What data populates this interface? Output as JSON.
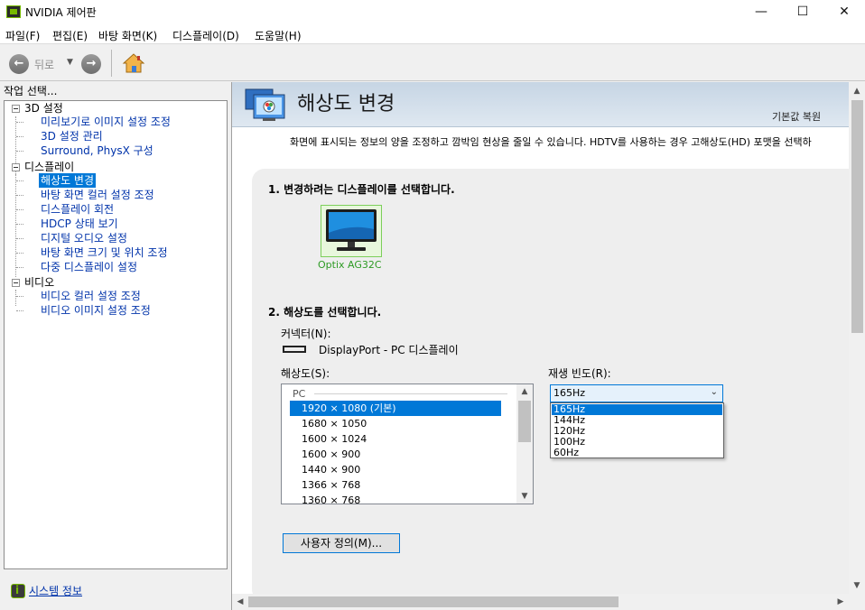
{
  "window": {
    "title": "NVIDIA 제어판",
    "min_glyph": "—",
    "max_glyph": "☐",
    "close_glyph": "✕"
  },
  "menu": [
    "파일(F)",
    "편집(E)",
    "바탕 화면(K)",
    "디스플레이(D)",
    "도움말(H)"
  ],
  "toolbar": {
    "back_label": "뒤로",
    "back_glyph": "←",
    "forward_glyph": "→",
    "dropdown_glyph": "▼",
    "home_icon": "home-icon"
  },
  "left_panel": {
    "header": "작업 선택...",
    "categories": [
      {
        "label": "3D 설정",
        "items": [
          "미리보기로 이미지 설정 조정",
          "3D 설정 관리",
          "Surround, PhysX 구성"
        ]
      },
      {
        "label": "디스플레이",
        "items": [
          "해상도 변경",
          "바탕 화면 컬러 설정 조정",
          "디스플레이 회전",
          "HDCP 상태 보기",
          "디지털 오디오 설정",
          "바탕 화면 크기 및 위치 조정",
          "다중 디스플레이 설정"
        ]
      },
      {
        "label": "비디오",
        "items": [
          "비디오 컬러 설정 조정",
          "비디오 이미지 설정 조정"
        ]
      }
    ],
    "selected_item": "해상도 변경",
    "system_info": "시스템 정보"
  },
  "page": {
    "title": "해상도 변경",
    "restore_defaults": "기본값 복원",
    "description": "화면에 표시되는 정보의 양을 조정하고 깜박임 현상을 줄일 수 있습니다. HDTV를 사용하는 경우 고해상도(HD) 포맷을 선택하",
    "section1_title": "1. 변경하려는 디스플레이를 선택합니다.",
    "display_name": "Optix AG32C",
    "section2_title": "2. 해상도를 선택합니다.",
    "connector_label": "커넥터(N):",
    "connector_value": "DisplayPort - PC 디스플레이",
    "resolution_label": "해상도(S):",
    "resolution_group": "PC",
    "resolutions": [
      "1920 × 1080 (기본)",
      "1680 × 1050",
      "1600 × 1024",
      "1600 × 900",
      "1440 × 900",
      "1366 × 768",
      "1360 × 768"
    ],
    "selected_resolution_index": 0,
    "refresh_label": "재생 빈도(R):",
    "refresh_value": "165Hz",
    "refresh_options": [
      "165Hz",
      "144Hz",
      "120Hz",
      "100Hz",
      "60Hz"
    ],
    "selected_refresh_index": 0,
    "custom_button": "사용자 정의(M)..."
  },
  "colors": {
    "accent": "#0078d7",
    "nvidia_green": "#76b900",
    "link": "#0033aa",
    "display_name_green": "#2c9a23"
  }
}
